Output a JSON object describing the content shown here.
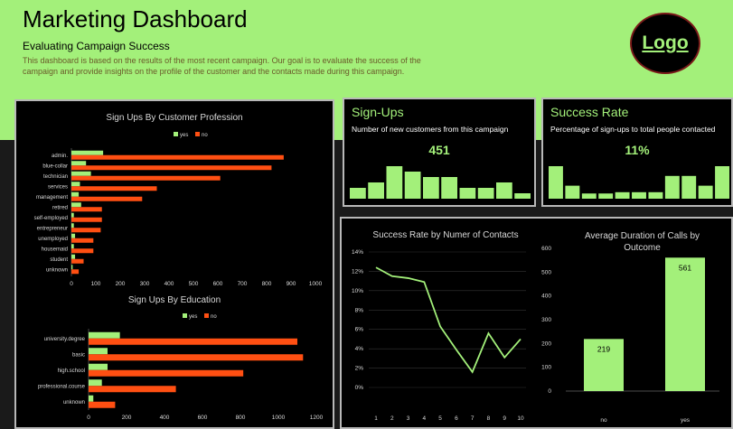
{
  "header": {
    "title": "Marketing Dashboard",
    "subtitle": "Evaluating Campaign Success",
    "description": "This dashboard is based on the results of the most recent campaign. Our goal is to evaluate the success of the campaign and provide insights on the profile of the customer and the contacts made during this campaign.",
    "logo": "Logo"
  },
  "colors": {
    "yes": "#a3f07a",
    "no": "#ff4f12",
    "accent": "#a3f07a"
  },
  "kpis": {
    "signups": {
      "title": "Sign-Ups",
      "subtitle": "Number of new customers from this campaign",
      "value": "451",
      "spark": [
        2,
        3,
        6,
        5,
        4,
        4,
        2,
        2,
        3,
        1
      ]
    },
    "success": {
      "title": "Success Rate",
      "subtitle": "Percentage of sign-ups to total people contacted",
      "value": "11%",
      "spark": [
        5,
        2,
        0.8,
        0.8,
        1,
        1,
        1,
        3.5,
        3.5,
        2,
        5
      ]
    }
  },
  "chart_data": [
    {
      "type": "bar",
      "title": "Sign Ups By Customer Profession",
      "categories": [
        "admin.",
        "blue-collar",
        "technician",
        "services",
        "management",
        "retired",
        "self-employed",
        "entrepreneur",
        "unemployed",
        "housemaid",
        "student",
        "unknown"
      ],
      "series": [
        {
          "name": "yes",
          "values": [
            130,
            60,
            80,
            35,
            30,
            40,
            10,
            10,
            15,
            10,
            15,
            5
          ]
        },
        {
          "name": "no",
          "values": [
            870,
            820,
            610,
            350,
            290,
            125,
            125,
            120,
            90,
            90,
            50,
            30
          ]
        }
      ],
      "xlim": [
        0,
        1000
      ],
      "xticks": [
        0,
        100,
        200,
        300,
        400,
        500,
        600,
        700,
        800,
        900,
        1000
      ],
      "legend": "top"
    },
    {
      "type": "bar",
      "title": "Sign Ups By Education",
      "categories": [
        "university.degree",
        "basic",
        "high.school",
        "professional.course",
        "unknown"
      ],
      "series": [
        {
          "name": "yes",
          "values": [
            165,
            100,
            100,
            70,
            25
          ]
        },
        {
          "name": "no",
          "values": [
            1100,
            1130,
            815,
            460,
            140
          ]
        }
      ],
      "xlim": [
        0,
        1200
      ],
      "xticks": [
        0,
        200,
        400,
        600,
        800,
        1000,
        1200
      ],
      "legend": "top"
    },
    {
      "type": "line",
      "title": "Success Rate by Numer of Contacts",
      "x": [
        1,
        2,
        3,
        4,
        5,
        6,
        7,
        8,
        9,
        10
      ],
      "values": [
        12.4,
        11.5,
        11.3,
        10.9,
        6.3,
        3.9,
        1.6,
        5.6,
        3.1,
        5.0
      ],
      "ylim": [
        0,
        14
      ],
      "yticks": [
        "0%",
        "2%",
        "4%",
        "6%",
        "8%",
        "10%",
        "12%",
        "14%"
      ]
    },
    {
      "type": "bar",
      "title": "Average Duration of Calls by Outcome",
      "categories": [
        "no",
        "yes"
      ],
      "values": [
        219,
        561
      ],
      "ylim": [
        0,
        600
      ],
      "yticks": [
        0,
        100,
        200,
        300,
        400,
        500,
        600
      ]
    }
  ]
}
